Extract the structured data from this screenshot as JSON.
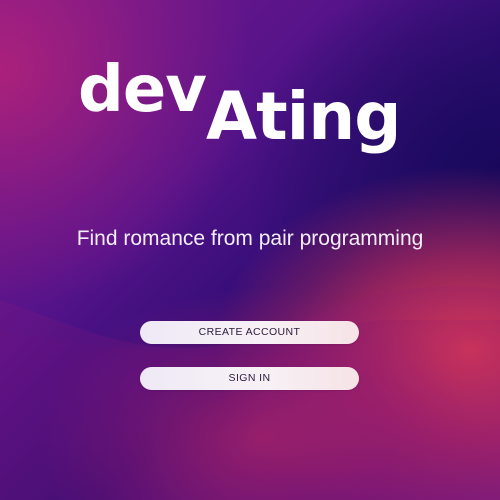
{
  "app": {
    "logo_part1": "dev",
    "logo_part2": "Ating",
    "tagline": "Find romance from pair programming"
  },
  "actions": {
    "create_account_label": "CREATE ACCOUNT",
    "sign_in_label": "SIGN IN"
  },
  "colors": {
    "logo_text": "#ffffff",
    "tagline_text": "#f4eef8",
    "button_background": "#f3eef6",
    "button_text": "#2a1a3a",
    "gradient_magenta": "#b42278",
    "gradient_navy": "#16085a",
    "gradient_red": "#e8404e",
    "gradient_purple": "#55138a"
  }
}
